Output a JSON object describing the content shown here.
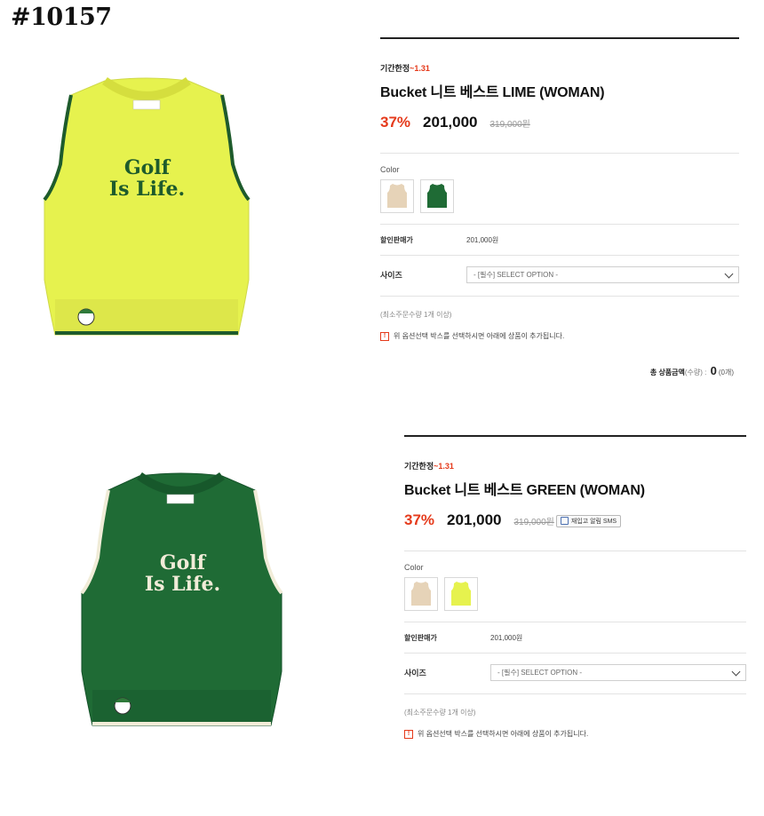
{
  "page_id": "#10157",
  "colors": {
    "accent_red": "#e53a1b",
    "lime": "#e6f24e",
    "green": "#1f6b35",
    "beige": "#e6d3b8"
  },
  "products": [
    {
      "promo_label": "기간한정",
      "promo_date": "~1.31",
      "title": "Bucket 니트 베스트 LIME (WOMAN)",
      "discount": "37%",
      "price": "201,000",
      "original_price": "319,000원",
      "color_label": "Color",
      "swatches": [
        "beige-vest-swatch",
        "green-vest-swatch"
      ],
      "sale_price_label": "할인판매가",
      "sale_price_value": "201,000원",
      "size_label": "사이즈",
      "size_select": "- [필수] SELECT OPTION -",
      "min_qty": "(최소주문수량 1개 이상)",
      "notice": "위 옵션선택 박스를 선택하시면 아래에 상품이 추가됩니다.",
      "total_label": "총 상품금액",
      "total_qty_label": "(수량) :",
      "total_value": "0",
      "total_count": "(0개)",
      "image_text": "Golf Is Life."
    },
    {
      "promo_label": "기간한정",
      "promo_date": "~1.31",
      "title": "Bucket 니트 베스트 GREEN (WOMAN)",
      "discount": "37%",
      "price": "201,000",
      "original_price": "319,000원",
      "restock_label": "재입고 알림 SMS",
      "color_label": "Color",
      "swatches": [
        "beige-vest-swatch",
        "lime-vest-swatch"
      ],
      "sale_price_label": "할인판매가",
      "sale_price_value": "201,000원",
      "size_label": "사이즈",
      "size_select": "- [필수] SELECT OPTION -",
      "min_qty": "(최소주문수량 1개 이상)",
      "notice": "위 옵션선택 박스를 선택하시면 아래에 상품이 추가됩니다.",
      "image_text": "Golf Is Life."
    }
  ]
}
